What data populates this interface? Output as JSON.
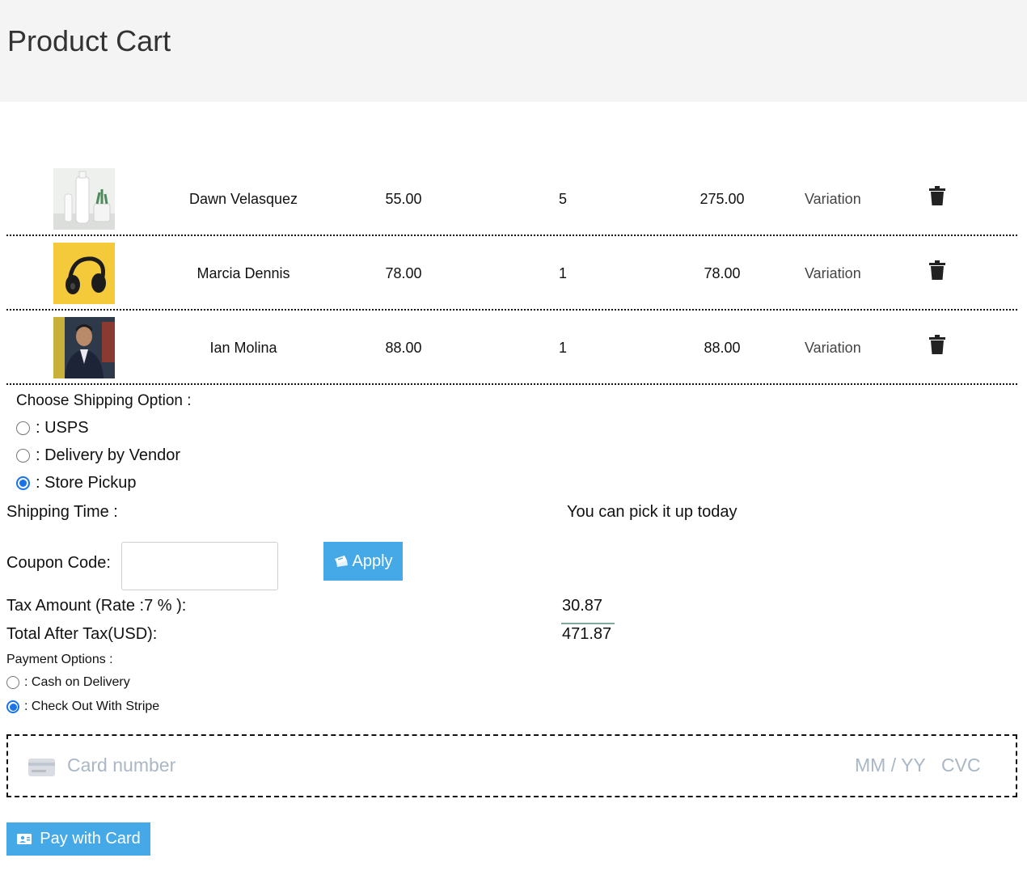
{
  "page": {
    "title": "Product Cart"
  },
  "cart": {
    "items": [
      {
        "name": "Dawn Velasquez",
        "price": "55.00",
        "quantity": "5",
        "total": "275.00",
        "variation": "Variation",
        "image": "white-bottles-product-photo"
      },
      {
        "name": "Marcia Dennis",
        "price": "78.00",
        "quantity": "1",
        "total": "78.00",
        "variation": "Variation",
        "image": "black-headphones-on-yellow-photo"
      },
      {
        "name": "Ian Molina",
        "price": "88.00",
        "quantity": "1",
        "total": "88.00",
        "variation": "Variation",
        "image": "man-portrait-photo"
      }
    ],
    "delete_icon": "trash-icon"
  },
  "shipping": {
    "heading": "Choose Shipping Option :",
    "options": [
      {
        "label": ": USPS",
        "selected": false
      },
      {
        "label": ": Delivery by Vendor",
        "selected": false
      },
      {
        "label": ": Store Pickup",
        "selected": true
      }
    ],
    "time_label": "Shipping Time :",
    "time_value": "You can pick it up today"
  },
  "coupon": {
    "label": "Coupon Code:",
    "value": "",
    "apply_label": "Apply",
    "apply_icon": "ticket-icon"
  },
  "summary": {
    "tax_label": "Tax Amount (Rate :7 % ):",
    "tax_value": "30.87",
    "total_label": "Total After Tax(USD):",
    "total_value": "471.87"
  },
  "payment": {
    "heading": "Payment Options :",
    "options": [
      {
        "label": ": Cash on Delivery",
        "selected": false
      },
      {
        "label": ": Check Out With Stripe",
        "selected": true
      }
    ],
    "card": {
      "icon": "credit-card-icon",
      "number_placeholder": "Card number",
      "expiry_placeholder": "MM / YY",
      "cvc_placeholder": "CVC"
    },
    "pay_label": "Pay with Card",
    "pay_icon": "payment-icon"
  },
  "colors": {
    "accent": "#45a9e8",
    "radio_selected": "#1a73e8",
    "header_bg": "#f4f4f4",
    "placeholder": "#aab7c4"
  }
}
